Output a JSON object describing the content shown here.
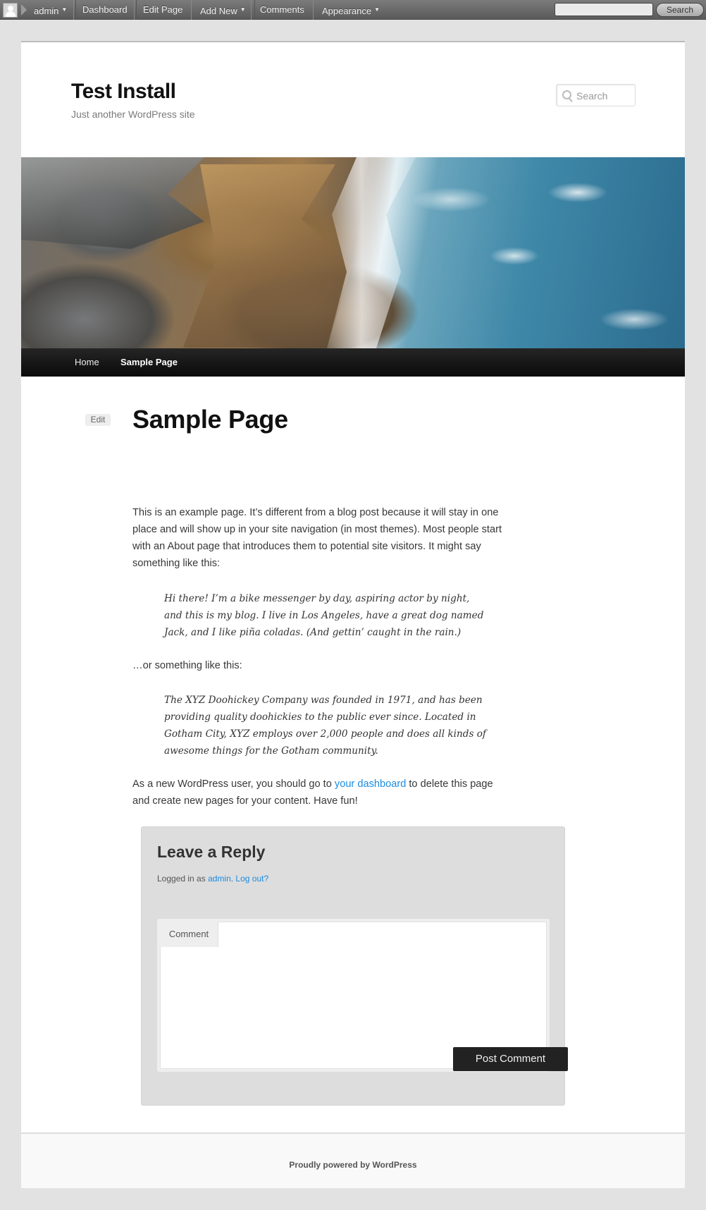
{
  "admin_bar": {
    "user": "admin",
    "items": [
      "Dashboard",
      "Edit Page",
      "Add New",
      "Comments",
      "Appearance"
    ],
    "search_button": "Search"
  },
  "site": {
    "title": "Test Install",
    "description": "Just another WordPress site",
    "search_placeholder": "Search"
  },
  "nav": {
    "items": [
      "Home",
      "Sample Page"
    ],
    "current": "Sample Page"
  },
  "entry": {
    "edit": "Edit",
    "title": "Sample Page",
    "para1": "This is an example page. It’s different from a blog post because it will stay in one place and will show up in your site navigation (in most themes). Most people start with an About page that introduces them to potential site visitors. It might say something like this:",
    "quote1": "Hi there! I’m a bike messenger by day, aspiring actor by night, and this is my blog. I live in Los Angeles, have a great dog named Jack, and I like piña coladas. (And gettin’ caught in the rain.)",
    "para2": "…or something like this:",
    "quote2": "The XYZ Doohickey Company was founded in 1971, and has been providing quality doohickies to the public ever since. Located in Gotham City, XYZ employs over 2,000 people and does all kinds of awesome things for the Gotham community.",
    "para3_before": "As a new WordPress user, you should go to ",
    "para3_link": "your dashboard",
    "para3_after": " to delete this page and create new pages for your content. Have fun!"
  },
  "reply": {
    "title": "Leave a Reply",
    "logged_in_prefix": "Logged in as ",
    "user_link": "admin",
    "logout_link": "Log out?",
    "comment_label": "Comment",
    "submit": "Post Comment"
  },
  "footer": {
    "text": "Proudly powered by WordPress"
  },
  "colors": {
    "link": "#1b8be0",
    "nav_bg": "#111111",
    "button_bg": "#222222"
  }
}
